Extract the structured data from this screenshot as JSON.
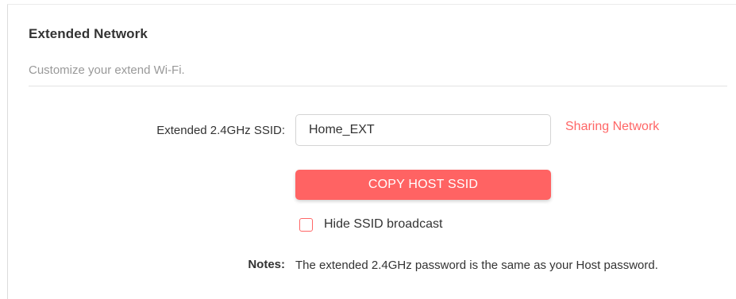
{
  "section": {
    "title": "Extended Network",
    "subtitle": "Customize your extend Wi-Fi."
  },
  "ssid": {
    "label": "Extended 2.4GHz SSID:",
    "value": "Home_EXT",
    "sharing_link": "Sharing Network"
  },
  "copy_button": {
    "label": "COPY HOST SSID"
  },
  "hide_broadcast": {
    "label": "Hide SSID broadcast",
    "checked": false
  },
  "notes": {
    "label": "Notes:",
    "text": "The extended 2.4GHz password is the same as your Host password."
  },
  "colors": {
    "accent": "#ff6363",
    "link": "#ff6666",
    "subtitle": "#999999"
  }
}
